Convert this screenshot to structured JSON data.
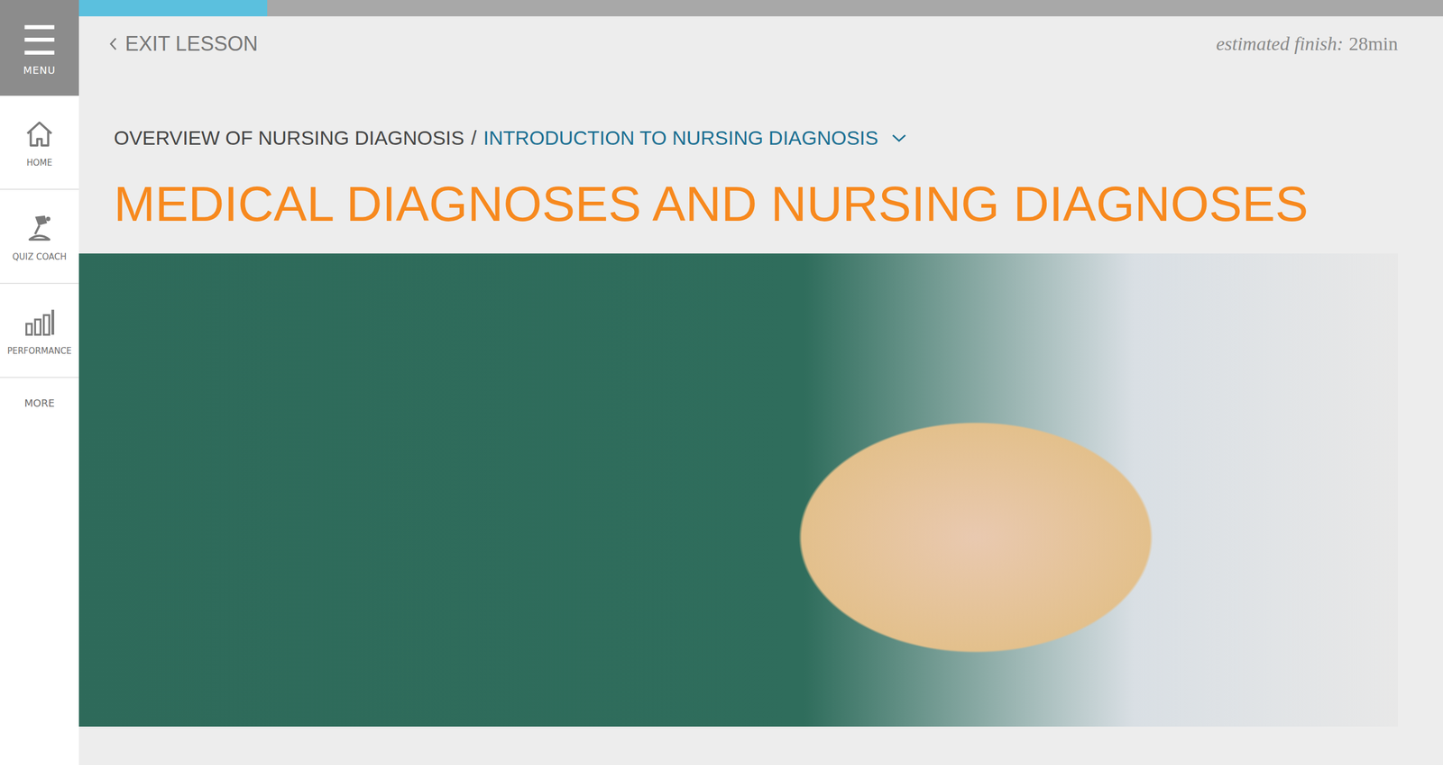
{
  "sidebar": {
    "menu": {
      "icon": "☰",
      "label": "MENU"
    },
    "items": [
      {
        "label": "HOME"
      },
      {
        "label": "QUIZ COACH"
      },
      {
        "label": "PERFORMANCE"
      },
      {
        "label": "MORE"
      }
    ]
  },
  "progress": {
    "level": 0.138
  },
  "header": {
    "exit": "EXIT LESSON",
    "estimate_label": "estimated finish:",
    "estimate_value": "28min"
  },
  "breadcrumb": {
    "parent": "OVERVIEW OF NURSING DIAGNOSIS",
    "separator": "/",
    "current": "INTRODUCTION TO NURSING DIAGNOSIS"
  },
  "title": "MEDICAL DIAGNOSES AND NURSING DIAGNOSES"
}
